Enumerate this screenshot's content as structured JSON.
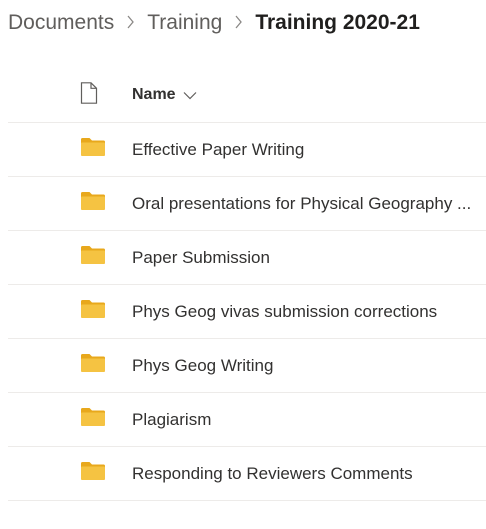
{
  "breadcrumb": {
    "items": [
      "Documents",
      "Training"
    ],
    "current": "Training 2020-21"
  },
  "list": {
    "header": {
      "file_type_icon": "file-icon",
      "name_label": "Name",
      "sort_icon": "chevron-down-icon"
    },
    "rows": [
      {
        "name": "Effective Paper Writing",
        "icon": "folder-icon"
      },
      {
        "name": "Oral presentations for Physical Geography ...",
        "icon": "folder-icon"
      },
      {
        "name": "Paper Submission",
        "icon": "folder-icon"
      },
      {
        "name": "Phys Geog vivas submission corrections",
        "icon": "folder-icon"
      },
      {
        "name": "Phys Geog Writing",
        "icon": "folder-icon"
      },
      {
        "name": "Plagiarism",
        "icon": "folder-icon"
      },
      {
        "name": "Responding to Reviewers Comments",
        "icon": "folder-icon"
      }
    ]
  },
  "colors": {
    "folder": "#f5c342",
    "folder_back": "#e8a81c",
    "divider": "#edebe9",
    "text": "#323130",
    "muted": "#605e5c"
  }
}
